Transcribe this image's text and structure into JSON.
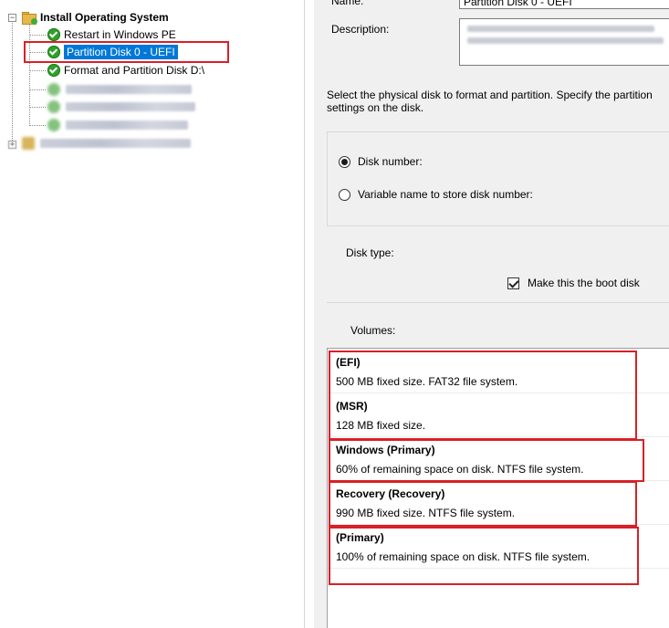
{
  "tree": {
    "root_label": "Install Operating System",
    "items": [
      {
        "label": "Restart in Windows PE",
        "state": "normal"
      },
      {
        "label": "Partition Disk 0 - UEFI",
        "state": "selected"
      },
      {
        "label": "Format and Partition Disk D:\\",
        "state": "normal"
      }
    ],
    "blurred_item_count": 4
  },
  "props": {
    "name_label": "Name:",
    "name_value": "Partition Disk 0 - UEFI",
    "description_label": "Description:",
    "instruction": "Select the physical disk to format and partition. Specify the partition settings on the disk.",
    "disk_number_label": "Disk number:",
    "variable_name_label": "Variable name to store disk number:",
    "disk_type_label": "Disk type:",
    "boot_disk_label": "Make this the boot disk",
    "volumes_label": "Volumes:"
  },
  "volumes": [
    {
      "title": "(EFI)",
      "desc": "500 MB fixed size. FAT32 file system."
    },
    {
      "title": "(MSR)",
      "desc": "128 MB fixed size."
    },
    {
      "title": "Windows (Primary)",
      "desc": "60% of remaining space on disk. NTFS file system."
    },
    {
      "title": "Recovery (Recovery)",
      "desc": "990 MB fixed size. NTFS file system."
    },
    {
      "title": "(Primary)",
      "desc": "100% of remaining space on disk. NTFS file system."
    }
  ],
  "colors": {
    "selection": "#0078d7",
    "highlight_box": "#d92027",
    "success_icon": "#2fa02a",
    "panel_bg": "#f0f0f0"
  }
}
